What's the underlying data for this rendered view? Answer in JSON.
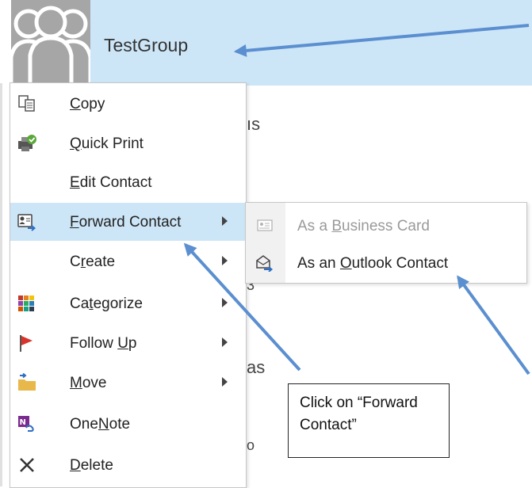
{
  "header": {
    "group_name": "TestGroup"
  },
  "background_fragments": [
    {
      "id": "a",
      "text": "ıs"
    },
    {
      "id": "b",
      "text": "3"
    },
    {
      "id": "c",
      "text": "as"
    },
    {
      "id": "d",
      "text": "o"
    }
  ],
  "context_menu": {
    "items": [
      {
        "pre": "",
        "u": "C",
        "post": "opy",
        "icon": "copy-icon"
      },
      {
        "pre": "",
        "u": "Q",
        "post": "uick Print",
        "icon": "quick-print-icon"
      },
      {
        "pre": "",
        "u": "E",
        "post": "dit Contact",
        "icon": ""
      },
      {
        "pre": "",
        "u": "F",
        "post": "orward Contact",
        "icon": "forward-contact-icon",
        "submenu": true,
        "highlighted": true
      },
      {
        "pre": "C",
        "u": "r",
        "post": "eate",
        "icon": "",
        "submenu": true
      },
      {
        "pre": "Ca",
        "u": "t",
        "post": "egorize",
        "icon": "categorize-icon",
        "submenu": true
      },
      {
        "pre": "Follow ",
        "u": "U",
        "post": "p",
        "icon": "follow-up-flag-icon",
        "submenu": true
      },
      {
        "pre": "",
        "u": "M",
        "post": "ove",
        "icon": "move-folder-icon",
        "submenu": true
      },
      {
        "pre": "One",
        "u": "N",
        "post": "ote",
        "icon": "onenote-icon"
      },
      {
        "pre": "",
        "u": "D",
        "post": "elete",
        "icon": "delete-icon"
      }
    ]
  },
  "submenu": {
    "items": [
      {
        "pre": "As a ",
        "u": "B",
        "post": "usiness Card",
        "icon": "business-card-icon",
        "disabled": true
      },
      {
        "pre": "As an ",
        "u": "O",
        "post": "utlook Contact",
        "icon": "outlook-contact-icon",
        "disabled": false
      }
    ]
  },
  "callout": {
    "line1": "Click on “Forward",
    "line2": "Contact”"
  },
  "colors": {
    "highlight": "#cde6f7",
    "arrow": "#5b8fd0",
    "avatar": "#a6a6a6"
  }
}
